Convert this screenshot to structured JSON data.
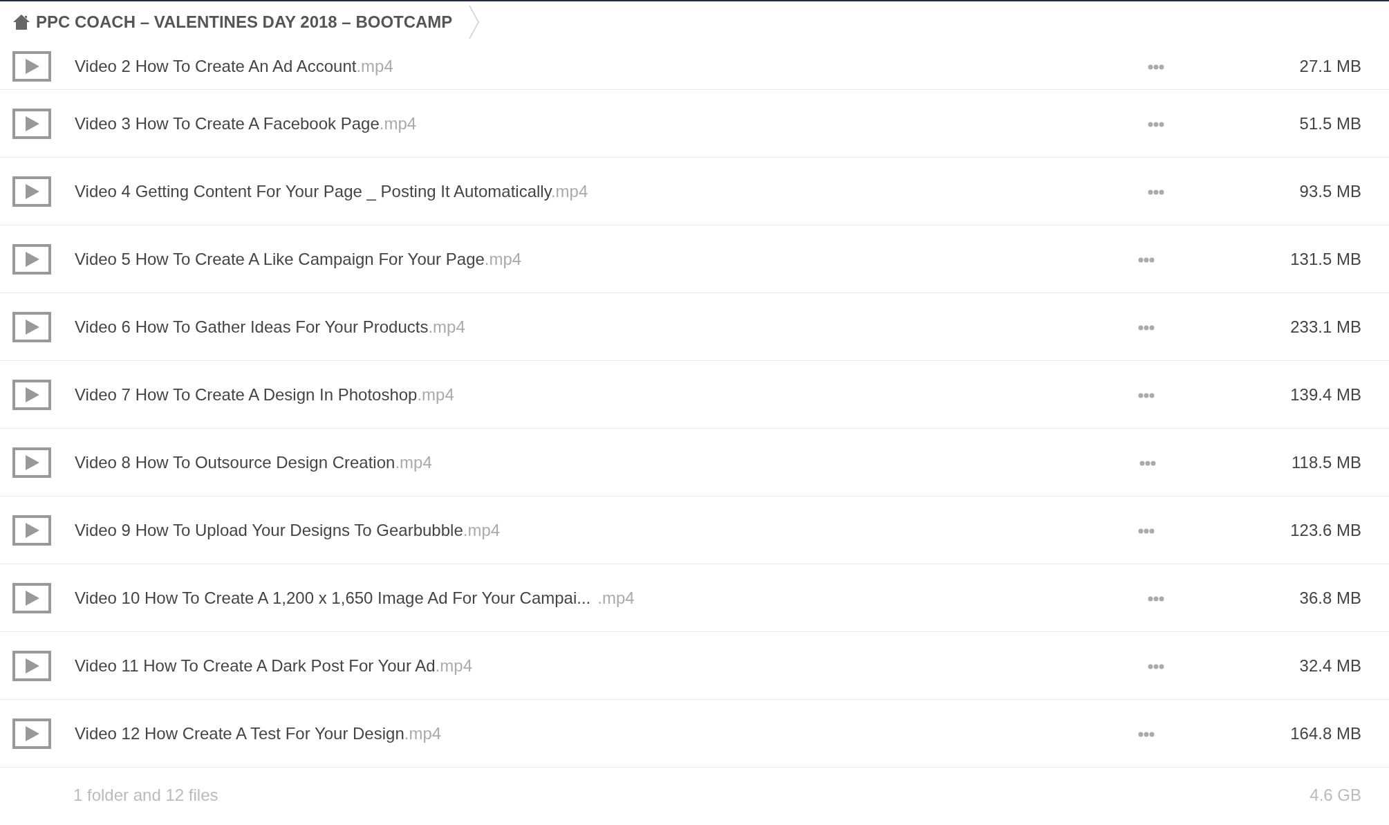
{
  "breadcrumb": {
    "title": "PPC COACH – VALENTINES DAY 2018 – BOOTCAMP"
  },
  "files": [
    {
      "kind": "full",
      "name": "Video 2 How To Create An Ad Account",
      "ext": ".mp4",
      "size": "27.1 MB"
    },
    {
      "kind": "full",
      "name": "Video 3 How To Create A Facebook Page",
      "ext": ".mp4",
      "size": "51.5 MB"
    },
    {
      "kind": "full",
      "name": "Video 4 Getting Content For Your Page _ Posting It Automatically",
      "ext": ".mp4",
      "size": "93.5 MB"
    },
    {
      "kind": "full",
      "name": "Video 5 How To Create A Like Campaign For Your Page",
      "ext": ".mp4",
      "size": "131.5 MB"
    },
    {
      "kind": "full",
      "name": "Video 6 How To Gather Ideas For Your Products",
      "ext": ".mp4",
      "size": "233.1 MB"
    },
    {
      "kind": "full",
      "name": "Video 7 How To Create A Design In Photoshop",
      "ext": ".mp4",
      "size": "139.4 MB"
    },
    {
      "kind": "full",
      "name": "Video 8 How To Outsource Design Creation",
      "ext": ".mp4",
      "size": "118.5 MB"
    },
    {
      "kind": "full",
      "name": "Video 9 How To Upload Your Designs To Gearbubble",
      "ext": ".mp4",
      "size": "123.6 MB"
    },
    {
      "kind": "truncated",
      "name": "Video 10 How To Create A 1,200 x 1,650 Image Ad For Your Campai...",
      "ext": ".mp4",
      "size": "36.8 MB"
    },
    {
      "kind": "full",
      "name": "Video 11 How To Create A Dark Post For Your Ad",
      "ext": ".mp4",
      "size": "32.4 MB"
    },
    {
      "kind": "full",
      "name": "Video 12 How Create A Test For Your Design",
      "ext": ".mp4",
      "size": "164.8 MB"
    }
  ],
  "footer": {
    "summary": "1 folder and 12 files",
    "total": "4.6 GB"
  }
}
